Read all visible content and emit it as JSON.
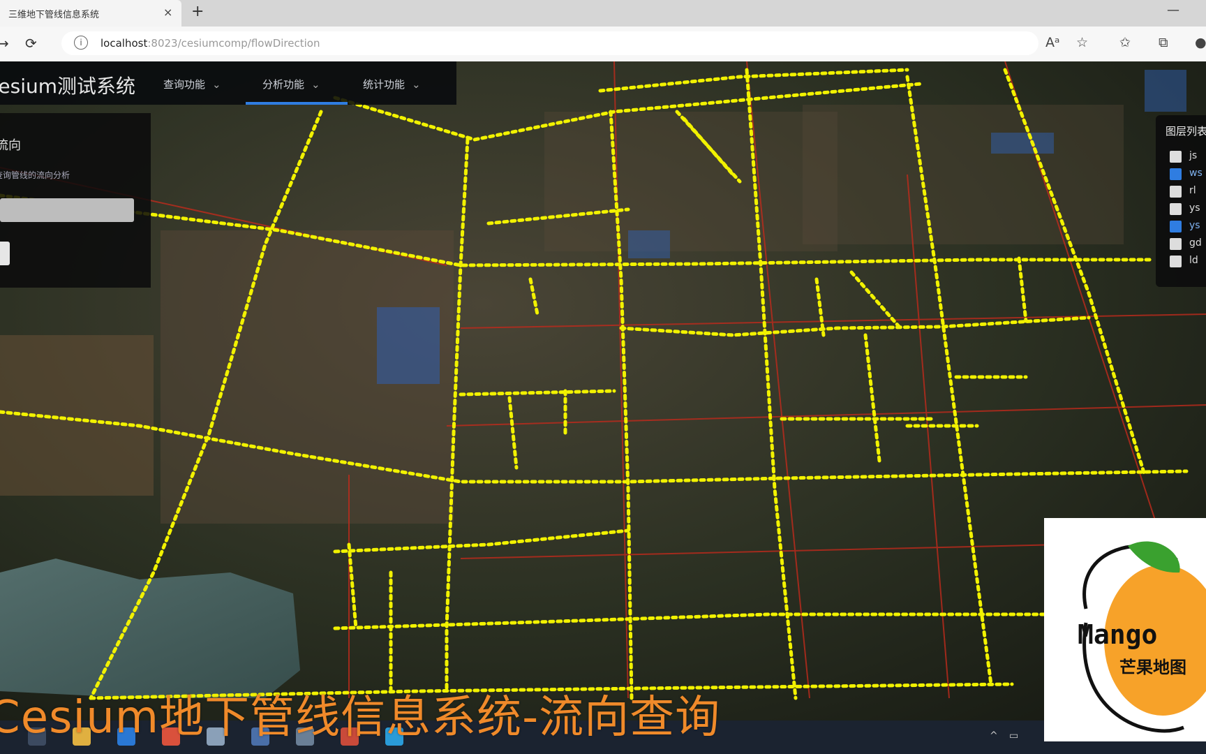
{
  "browser": {
    "tab_title": "三维地下管线信息系统",
    "tab_close": "×",
    "new_tab": "+",
    "window_min": "—",
    "url_host": "localhost",
    "url_path": ":8023/cesiumcomp/flowDirection",
    "url_icon": "info-icon"
  },
  "app": {
    "title": "cesium测试系统",
    "menus": [
      {
        "label": "查询功能"
      },
      {
        "label": "分析功能"
      },
      {
        "label": "统计功能"
      }
    ],
    "active_menu_index": 1
  },
  "left_panel": {
    "title": "流向",
    "subtitle": "查询管线的流向分析"
  },
  "layer_panel": {
    "title": "图层列表",
    "layers": [
      {
        "label": "js",
        "checked": false
      },
      {
        "label": "ws",
        "checked": true
      },
      {
        "label": "rl",
        "checked": false
      },
      {
        "label": "ys",
        "checked": false
      },
      {
        "label": "ys",
        "checked": true
      },
      {
        "label": "gd",
        "checked": false
      },
      {
        "label": "ld",
        "checked": false
      }
    ]
  },
  "caption": "Cesium地下管线信息系统-流向查询",
  "logo": {
    "brand": "Mango",
    "subtitle": "芒果地图"
  },
  "colors": {
    "pipe": "#f2f200",
    "parcel": "#c02a1c",
    "accent": "#2f7de1",
    "caption": "#f08a2a",
    "logo_orange": "#f7a229",
    "logo_leaf": "#3aa12f"
  }
}
